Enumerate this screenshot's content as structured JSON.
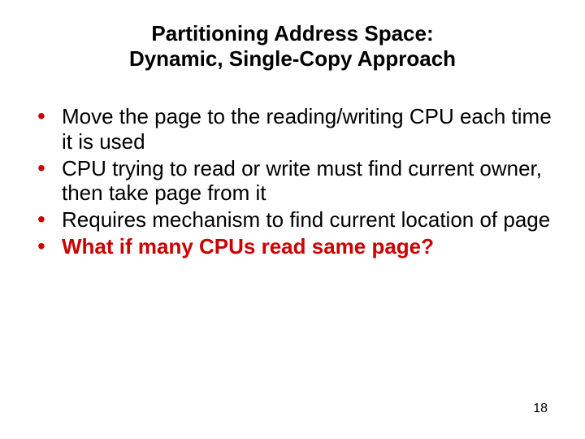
{
  "title_line1": "Partitioning Address Space:",
  "title_line2": "Dynamic, Single-Copy Approach",
  "bullets": [
    {
      "text": "Move the page to the reading/writing CPU each time it is used",
      "emph": false
    },
    {
      "text": "CPU trying to read or write must find current owner, then take page from it",
      "emph": false
    },
    {
      "text": "Requires mechanism to find current location of page",
      "emph": false
    },
    {
      "text": "What if many CPUs read same page?",
      "emph": true
    }
  ],
  "page_number": "18",
  "colors": {
    "accent": "#cc0000"
  }
}
